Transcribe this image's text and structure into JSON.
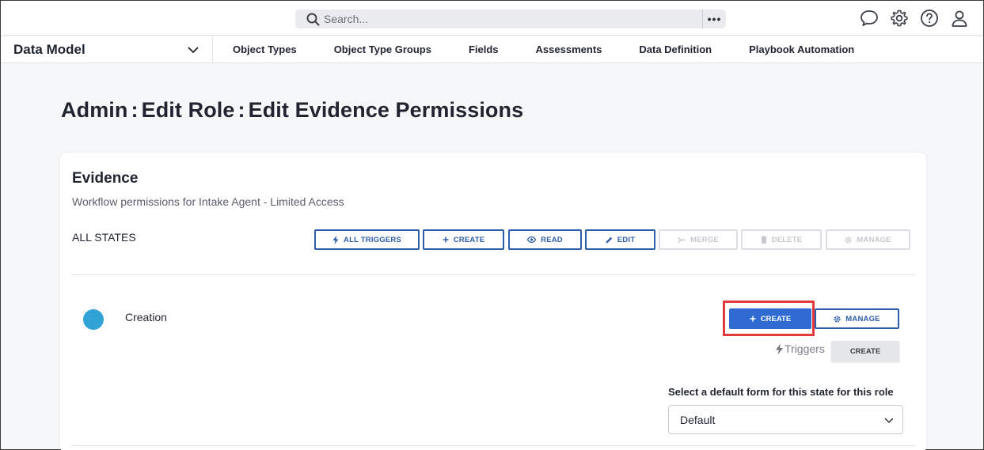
{
  "search": {
    "placeholder": "Search...",
    "more": "•••"
  },
  "topIcons": [
    "chat-icon",
    "gear-icon",
    "help-icon",
    "user-icon"
  ],
  "module": {
    "label": "Data Model"
  },
  "nav": {
    "items": [
      {
        "label": "Object Types"
      },
      {
        "label": "Object Type Groups"
      },
      {
        "label": "Fields"
      },
      {
        "label": "Assessments"
      },
      {
        "label": "Data Definition"
      },
      {
        "label": "Playbook Automation"
      }
    ]
  },
  "page": {
    "title_parts": [
      "Admin",
      "Edit Role",
      "Edit Evidence Permissions"
    ],
    "separator": ":"
  },
  "card": {
    "title": "Evidence",
    "subtitle": "Workflow permissions for Intake Agent - Limited Access",
    "all_states_label": "ALL STATES",
    "all_states_buttons": {
      "all_triggers": "ALL TRIGGERS",
      "create": "CREATE",
      "read": "READ",
      "edit": "EDIT",
      "merge": "MERGE",
      "delete": "DELETE",
      "manage": "MANAGE"
    },
    "state": {
      "name": "Creation",
      "color": "#2fa3d6",
      "create_label": "CREATE",
      "manage_label": "MANAGE",
      "triggers_label": "Triggers",
      "trigger_create_label": "CREATE",
      "form_label": "Select a default form for this state for this role",
      "form_value": "Default"
    }
  },
  "colors": {
    "accent": "#2f6bd1",
    "outline": "#2d5da8",
    "highlight": "#e33b3b"
  }
}
